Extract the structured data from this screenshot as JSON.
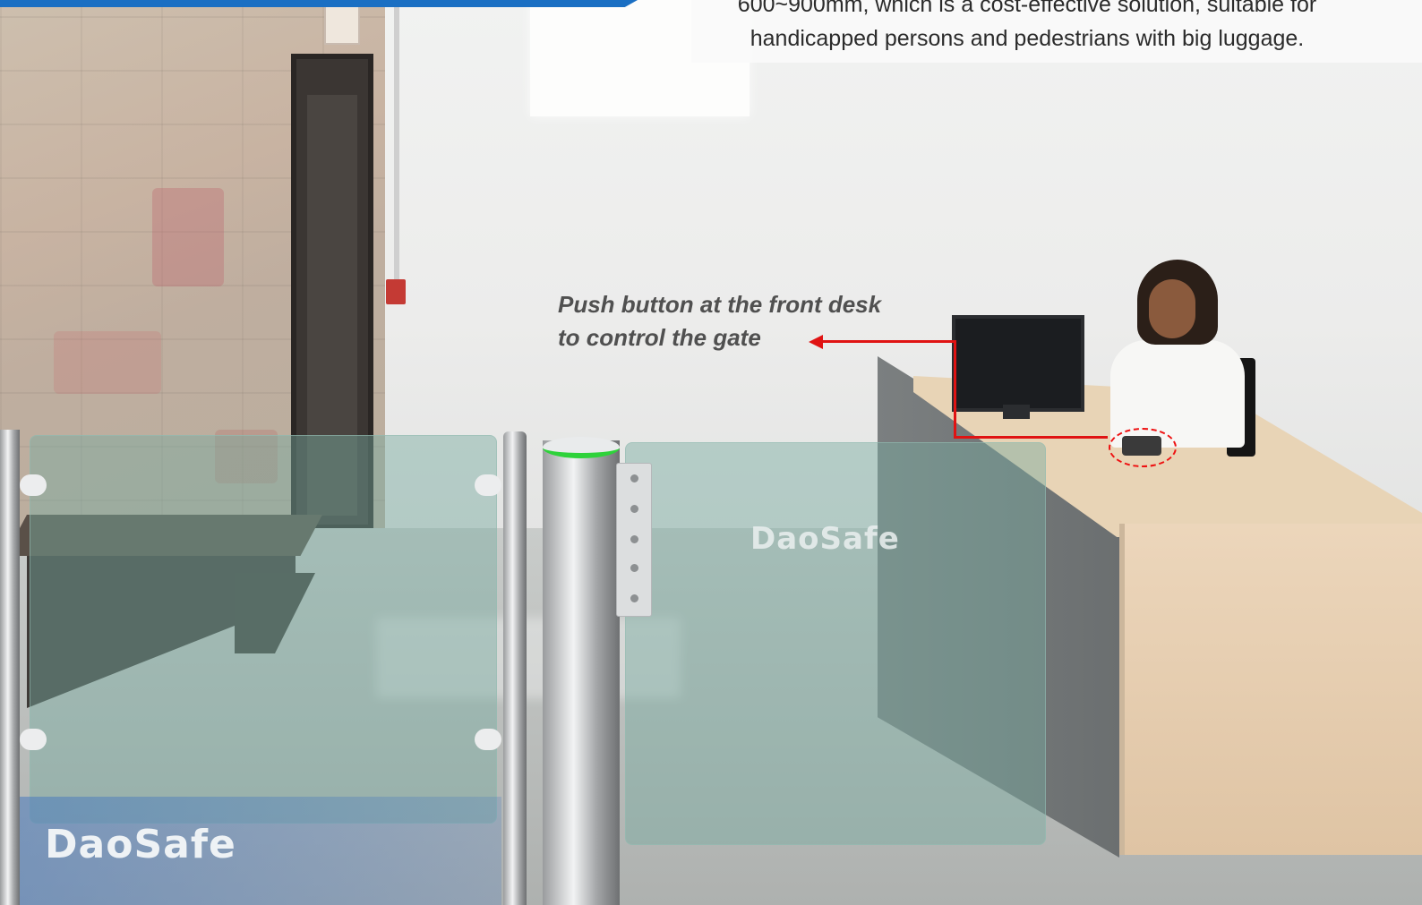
{
  "header": {
    "caption_line1": "600~900mm, which is a cost-effective solution, suitable for",
    "caption_line2": "handicapped persons and pedestrians with big luggage."
  },
  "callout": {
    "line1": "Push button at the front desk",
    "line2": "to control the gate"
  },
  "brand": {
    "watermark_center": "DaoSafe",
    "watermark_corner": "DaoSafe"
  },
  "colors": {
    "accent_blue": "#1a6fc3",
    "callout_red": "#e01313",
    "gate_led_green": "#2ed23a"
  }
}
